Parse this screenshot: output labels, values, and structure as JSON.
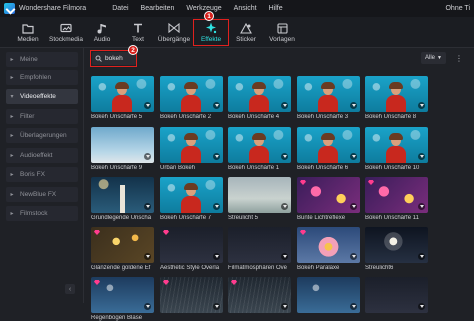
{
  "app": {
    "title": "Wondershare Filmora",
    "right_label": "Ohne Ti"
  },
  "menu": [
    "Datei",
    "Bearbeiten",
    "Werkzeuge",
    "Ansicht",
    "Hilfe"
  ],
  "toolbar": [
    {
      "label": "Medien",
      "icon": "folder-icon"
    },
    {
      "label": "Stockmedia",
      "icon": "cloud-icon"
    },
    {
      "label": "Audio",
      "icon": "music-note-icon"
    },
    {
      "label": "Text",
      "icon": "text-icon"
    },
    {
      "label": "Übergänge",
      "icon": "transition-icon"
    },
    {
      "label": "Effekte",
      "icon": "sparkle-icon",
      "active": true
    },
    {
      "label": "Sticker",
      "icon": "sticker-icon"
    },
    {
      "label": "Vorlagen",
      "icon": "template-icon"
    }
  ],
  "callouts": [
    "1",
    "2"
  ],
  "sidebar": [
    {
      "label": "Meine"
    },
    {
      "label": "Empfohlen"
    },
    {
      "label": "Videoeffekte",
      "active": true
    },
    {
      "label": "Filter"
    },
    {
      "label": "Überlagerungen"
    },
    {
      "label": "Audioeffekt"
    },
    {
      "label": "Boris FX"
    },
    {
      "label": "NewBlue FX"
    },
    {
      "label": "Filmstock"
    }
  ],
  "search": {
    "value": "bokeh"
  },
  "filter": {
    "value": "Alle"
  },
  "accent_color": "#2fe3e3",
  "annotation_color": "#e0211e",
  "effects": [
    {
      "label": "Bokeh Unschärfe 5",
      "art": "art-bokeh figure",
      "premium": false
    },
    {
      "label": "Bokeh Unschärfe 2",
      "art": "art-bokeh figure",
      "premium": false
    },
    {
      "label": "Bokeh Unschärfe 4",
      "art": "art-bokeh figure",
      "premium": false
    },
    {
      "label": "Bokeh Unschärfe 3",
      "art": "art-bokeh figure",
      "premium": false
    },
    {
      "label": "Bokeh Unschärfe 8",
      "art": "art-bokeh figure",
      "premium": false
    },
    {
      "label": "Bokeh Unschärfe 9",
      "art": "art-sky",
      "premium": false
    },
    {
      "label": "Urban Bokeh",
      "art": "art-bokeh figure",
      "premium": false
    },
    {
      "label": "Bokeh Unschärfe 1",
      "art": "art-bokeh figure",
      "premium": false
    },
    {
      "label": "Bokeh Unschärfe 6",
      "art": "art-bokeh figure",
      "premium": false
    },
    {
      "label": "Bokeh Unschärfe 10",
      "art": "art-bokeh figure",
      "premium": false
    },
    {
      "label": "Grundlegende Unschä",
      "art": "art-tower",
      "premium": false
    },
    {
      "label": "Bokeh Unschärfe 7",
      "art": "art-bokeh figure",
      "premium": false
    },
    {
      "label": "Streulicht 5",
      "art": "art-mist",
      "premium": false
    },
    {
      "label": "Bunte Lichtreflexe",
      "art": "art-pink",
      "premium": true
    },
    {
      "label": "Bokeh Unschärfe 11",
      "art": "art-pink",
      "premium": true
    },
    {
      "label": "Glänzende goldene Ef",
      "art": "art-gold",
      "premium": true
    },
    {
      "label": "Aesthetic Style Overla",
      "art": "art-dark",
      "premium": true
    },
    {
      "label": "Filmatmosphären Ove",
      "art": "art-dark",
      "premium": false
    },
    {
      "label": "Bokeh Paralaxe",
      "art": "art-flower",
      "premium": true
    },
    {
      "label": "Streulicht6",
      "art": "art-moon",
      "premium": false
    },
    {
      "label": "Regenbogen Blase",
      "art": "art-water",
      "premium": true
    },
    {
      "label": "",
      "art": "art-rain",
      "premium": true
    },
    {
      "label": "",
      "art": "art-rain",
      "premium": true
    },
    {
      "label": "",
      "art": "art-water",
      "premium": false
    },
    {
      "label": "",
      "art": "art-dark",
      "premium": false
    },
    {
      "label": "",
      "art": "art-rain",
      "premium": false
    }
  ]
}
